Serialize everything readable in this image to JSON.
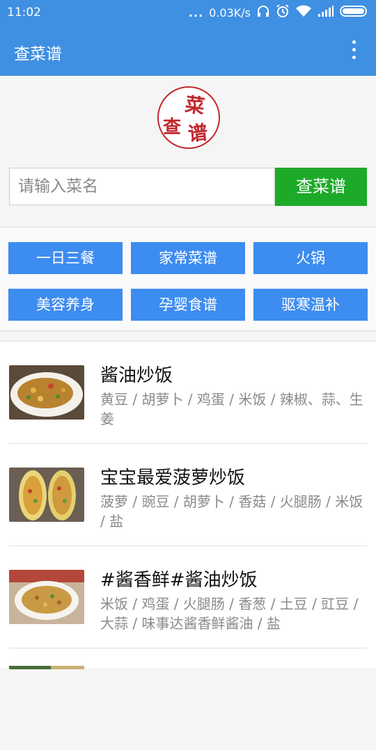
{
  "statusbar": {
    "time": "11:02",
    "dots": "...",
    "speed": "0.03K/s"
  },
  "appbar": {
    "title": "查菜谱"
  },
  "logo": {
    "chars": [
      "菜",
      "查",
      "谱"
    ]
  },
  "search": {
    "placeholder": "请输入菜名",
    "button": "查菜谱"
  },
  "categories": [
    "一日三餐",
    "家常菜谱",
    "火锅",
    "美容养身",
    "孕婴食谱",
    "驱寒温补"
  ],
  "recipes": [
    {
      "title": "酱油炒饭",
      "ingredients": "黄豆 / 胡萝卜 / 鸡蛋 / 米饭 / 辣椒、蒜、生姜"
    },
    {
      "title": "宝宝最爱菠萝炒饭",
      "ingredients": "菠萝 / 豌豆 / 胡萝卜 / 香菇 / 火腿肠 / 米饭 / 盐"
    },
    {
      "title": "#酱香鲜#酱油炒饭",
      "ingredients": "米饭 / 鸡蛋 / 火腿肠 / 香葱 / 土豆 / 豇豆 / 大蒜 / 味事达酱香鲜酱油 / 盐"
    }
  ],
  "colors": {
    "primary": "#3f8fe2",
    "category": "#3d8cf0",
    "search_button": "#1eaa29",
    "logo_red": "#c1272d"
  }
}
